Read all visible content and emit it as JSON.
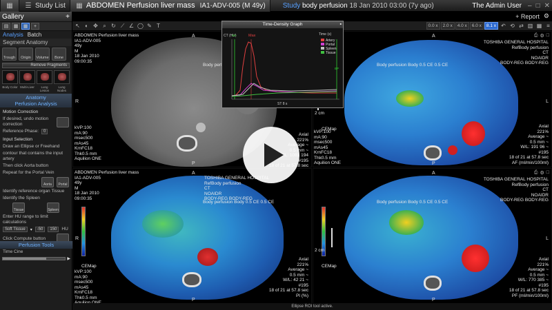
{
  "topbar": {
    "gallery_tab": "Gallery",
    "studylist_tab": "Study List",
    "title": "ABDOMEN Perfusion liver mass",
    "patient": "IA1-ADV-005 (M 49y)",
    "study_word": "Study",
    "study_name": "body perfusion",
    "study_date": "18 Jan 2010 03:00 (7y ago)",
    "user": "The Admin User",
    "report": "+ Report"
  },
  "gallery": {
    "header": "Gallery",
    "subtabs": [
      "Analysis",
      "Batch"
    ],
    "segment_label": "Segment Anatomy",
    "seg_icons": [
      "Trough",
      "Origin",
      "Volume",
      "Bone",
      "Vessel",
      "Kidney"
    ],
    "remove_fragments": "Remove Fragments",
    "thumb_labels": [
      "Body Color",
      "Multi-Liver",
      "Lung Lesion",
      "Lung Nodes"
    ],
    "panel_title_1": "Anatomy",
    "panel_title_2": "Perfusion Analysis",
    "motion_correction_hd": "Motion Correction",
    "motion_text": "If desired, undo motion correction",
    "ref_phase_label": "Reference Phase:",
    "ref_phase_value": "0",
    "input_selection": "Input Selection",
    "instr_1": "Draw an Ellipse or Freehand",
    "instr_2": "contour that contains the input artery",
    "instr_3": "Then click Aorta button",
    "instr_4": "Repeat for the Portal Vein",
    "btn_aorta": "Aorta",
    "btn_portal": "Portal",
    "identify_ref": "Identify reference organ Tissue",
    "identify_spleen": "Identify the Spleen",
    "btn_tissue": "Tissue",
    "btn_spleen": "Spleen",
    "enter_hu": "Enter HU range to limit calculations",
    "soft_tissue": "Soft Tissue",
    "hu_low": "-50",
    "hu_high": "150",
    "hu_unit": "HU",
    "click_compute": "Click Compute button",
    "perfusion_tools": "Perfusion Tools",
    "time_cine": "Time Cine"
  },
  "toolbar": {
    "zoom_levels": [
      "0.0 x",
      "2.0 x",
      "4.0 x",
      "6.0 x",
      "8.1 x"
    ],
    "zoom_active": 4
  },
  "tdc": {
    "title": "Time-Density Graph",
    "ylabel": "CT (HU)",
    "xlabel": "Time (s)",
    "max_label": "Max",
    "st_label": "ST 8 s",
    "marker_left": "SH",
    "marker_right": "EP",
    "legend": [
      {
        "name": "Artery",
        "color": "#e04040"
      },
      {
        "name": "Portal",
        "color": "#d040d0"
      },
      {
        "name": "Spleen",
        "color": "#c0c0c0"
      },
      {
        "name": "Tissue",
        "color": "#40c040"
      }
    ]
  },
  "viewports": {
    "tl": {
      "hdr": "ABDOMEN Perfusion liver mass\nIA1-ADV-005\n49y\nM\n18 Jan 2010\n09:00:35",
      "mid": "Body perfusion",
      "orient_top": "A",
      "orient_left": "R",
      "orient_bottom": "P",
      "params": "kVP:100\nmA:90\nmsec500\nmAs45\nKrnFC18\nThk0.5 mm\nAquilion ONE",
      "right": "Axial\n221%\nAverage ~\n0.5 mm ~\nW/L: 1081 194\n#195\n18 of 21 at 57.8 sec"
    },
    "tr": {
      "hdr": "TOSHIBA GENERAL HOSPITAL\nRefBody perfusion\nCT\nNOAIDR\nBODY-REG BODY-REG",
      "mid": "Body perfusion Body 0.5 CE 0.5 CE",
      "orient_top": "A",
      "orient_right": "L",
      "orient_bottom": "P",
      "scale": "2 cm",
      "colormap": "CEMap",
      "right": "Axial\n221%\nAverage ~\n0.5 mm ~\nW/L: 191 96 ~\n#195\n18 of 21 at 57.8 sec\nAF (ml/min/100ml)"
    },
    "bl": {
      "hdr": "ABDOMEN Perfusion liver mass\nIA1-ADV-005\n49y\nM\n18 Jan 2010\n09:00:35",
      "mid": "Body perfusion Body 0.5 CE 0.5 CE",
      "orient_top": "A",
      "orient_left": "R",
      "orient_bottom": "P",
      "params": "kVP:100\nmA:90\nmsec500\nmAs45\nKrnFC18\nThk0.5 mm\nAquilion ONE",
      "right": "Axial\n221%\nAverage ~\n0.5 mm ~\nW/L: 42 21 ~\n#195\n18 of 21 at 57.8 sec\nPI (%)",
      "scale": "2 cm",
      "colormap": "CEMap",
      "hospital": "TOSHIBA GENERAL HOSPITAL\nRefBody perfusion\nCT\nNOAIDR\nBODY-REG BODY-REG"
    },
    "br": {
      "hdr": "TOSHIBA GENERAL HOSPITAL\nRefBody perfusion\nCT\nNOAIDR\nBODY-REG BODY-REG",
      "mid": "Body perfusion Body 0.5 CE 0.5 CE",
      "orient_top": "A",
      "orient_right": "L",
      "orient_bottom": "P",
      "scale": "2 cm",
      "colormap": "CEMap",
      "right": "Axial\n221%\nAverage ~\n0.5 mm ~\nW/L: 770 385 ~\n#195\n18 of 21 at 57.8 sec\nPF (ml/min/100ml)"
    },
    "mid_params": "kVP:100\nmA:90\nmsec500\nmAs45\nKrnFC18\nThk0.5 mm\nAquilion ONE"
  },
  "status": "Ellipse ROI tool active."
}
